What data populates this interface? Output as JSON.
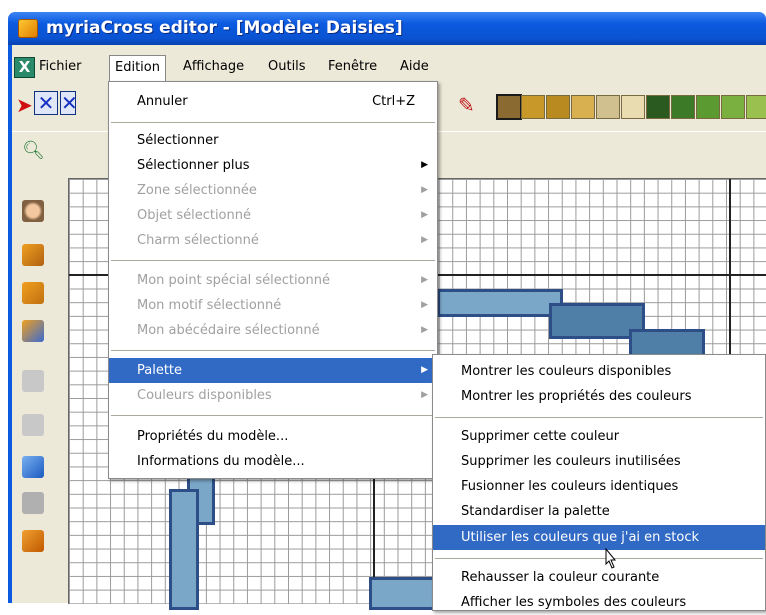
{
  "window": {
    "title": "myriaCross editor - [Modèle: Daisies]"
  },
  "menubar": {
    "items": [
      "Fichier",
      "Edition",
      "Affichage",
      "Outils",
      "Fenêtre",
      "Aide"
    ]
  },
  "toolbar": {
    "swatch_colors": [
      "#8a6a30",
      "#c89828",
      "#b88a20",
      "#d8b050",
      "#d0c090",
      "#e8dcb0",
      "#2a5a20",
      "#3c7a28",
      "#5a9a30",
      "#7ab040",
      "#9ac050"
    ]
  },
  "edit_menu": {
    "items": [
      {
        "label": "Annuler",
        "shortcut": "Ctrl+Z",
        "enabled": true
      },
      {
        "label": "Sélectionner",
        "enabled": true
      },
      {
        "label": "Sélectionner plus",
        "enabled": true,
        "submenu": true
      },
      {
        "label": "Zone sélectionnée",
        "enabled": false,
        "submenu": true
      },
      {
        "label": "Objet sélectionné",
        "enabled": false,
        "submenu": true
      },
      {
        "label": "Charm sélectionné",
        "enabled": false,
        "submenu": true
      },
      {
        "label": "Mon point spécial sélectionné",
        "enabled": false,
        "submenu": true
      },
      {
        "label": "Mon motif sélectionné",
        "enabled": false,
        "submenu": true
      },
      {
        "label": "Mon abécédaire sélectionné",
        "enabled": false,
        "submenu": true
      },
      {
        "label": "Palette",
        "enabled": true,
        "submenu": true,
        "highlighted": true
      },
      {
        "label": "Couleurs disponibles",
        "enabled": false,
        "submenu": true
      },
      {
        "label": "Propriétés du modèle...",
        "enabled": true
      },
      {
        "label": "Informations du modèle...",
        "enabled": true
      }
    ]
  },
  "palette_submenu": {
    "items": [
      {
        "label": "Montrer les couleurs disponibles"
      },
      {
        "label": "Montrer les propriétés des couleurs"
      },
      {
        "label": "Supprimer cette couleur"
      },
      {
        "label": "Supprimer les couleurs inutilisées"
      },
      {
        "label": "Fusionner les couleurs identiques"
      },
      {
        "label": "Standardiser la palette"
      },
      {
        "label": "Utiliser les couleurs que j'ai en stock",
        "highlighted": true
      },
      {
        "label": "Rehausser la couleur courante"
      },
      {
        "label": "Afficher les symboles des couleurs"
      }
    ]
  },
  "colors": {
    "highlight": "#316ac5",
    "titlebar": "#0b5ae0",
    "stitch_border": "#2d4e86"
  }
}
